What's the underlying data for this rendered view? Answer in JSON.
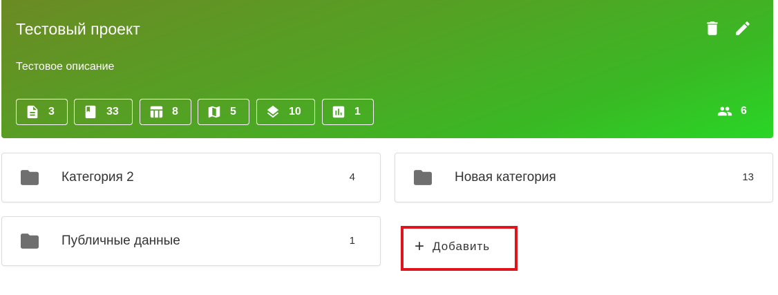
{
  "project": {
    "title": "Тестовый проект",
    "description": "Тестовое описание",
    "gradient": [
      "#6b8a24",
      "#29d626"
    ],
    "actions": [
      {
        "icon": "trash-icon"
      },
      {
        "icon": "pencil-icon"
      }
    ],
    "stats": [
      {
        "icon": "document-icon",
        "count": "3"
      },
      {
        "icon": "bookmark-book-icon",
        "count": "33"
      },
      {
        "icon": "table-icon",
        "count": "8"
      },
      {
        "icon": "map-icon",
        "count": "5"
      },
      {
        "icon": "layers-icon",
        "count": "10"
      },
      {
        "icon": "bar-chart-icon",
        "count": "1"
      }
    ],
    "members": {
      "icon": "people-icon",
      "count": "6"
    }
  },
  "categories": [
    {
      "icon": "folder-icon",
      "name": "Категория 2",
      "count": "4"
    },
    {
      "icon": "folder-icon",
      "name": "Новая категория",
      "count": "13"
    },
    {
      "icon": "folder-icon",
      "name": "Публичные данные",
      "count": "1"
    }
  ],
  "add_button": {
    "icon": "plus-icon",
    "label": "Добавить",
    "highlight_color": "#e0141c"
  }
}
